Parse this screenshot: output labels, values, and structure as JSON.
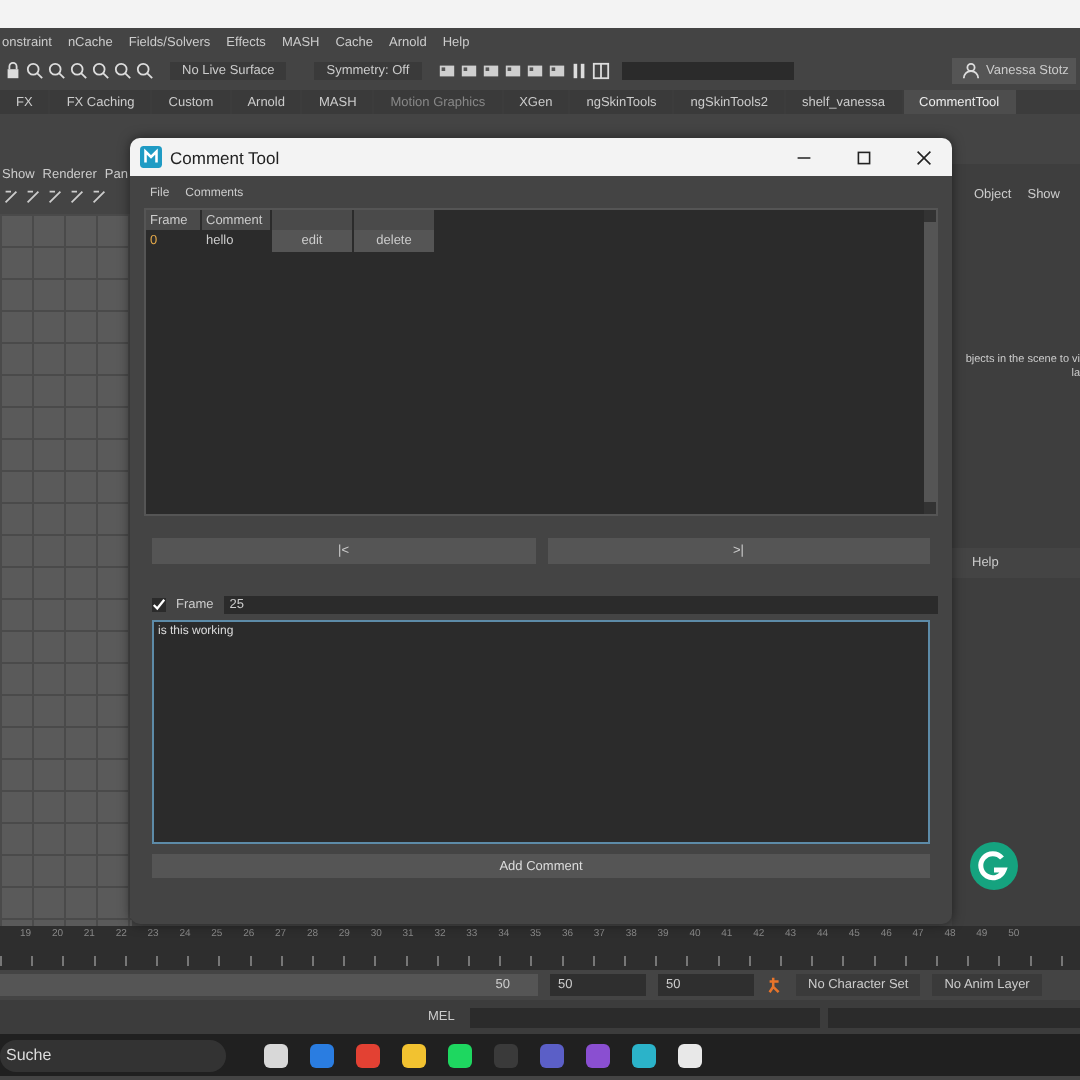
{
  "menubar": [
    "onstraint",
    "nCache",
    "Fields/Solvers",
    "Effects",
    "MASH",
    "Cache",
    "Arnold",
    "Help"
  ],
  "toolbar": {
    "surface": "No Live Surface",
    "symmetry": "Symmetry: Off",
    "user": "Vanessa Stotz"
  },
  "shelf_tabs": [
    {
      "label": "FX",
      "selected": false
    },
    {
      "label": "FX Caching",
      "selected": false
    },
    {
      "label": "Custom",
      "selected": false
    },
    {
      "label": "Arnold",
      "selected": false
    },
    {
      "label": "MASH",
      "selected": false
    },
    {
      "label": "Motion Graphics",
      "selected": false
    },
    {
      "label": "XGen",
      "selected": false
    },
    {
      "label": "ngSkinTools",
      "selected": false
    },
    {
      "label": "ngSkinTools2",
      "selected": false
    },
    {
      "label": "shelf_vanessa",
      "selected": false
    },
    {
      "label": "CommentTool",
      "selected": true
    }
  ],
  "left_panel": {
    "menu": [
      "Show",
      "Renderer",
      "Pan"
    ]
  },
  "right_panel": {
    "menu": [
      "Object",
      "Show"
    ],
    "hint_lines": [
      "bjects in the scene to vi",
      "la"
    ],
    "lower_menu": [
      "Help"
    ]
  },
  "dialog": {
    "title": "Comment Tool",
    "menu": [
      "File",
      "Comments"
    ],
    "table": {
      "columns": [
        "Frame",
        "Comment"
      ],
      "rows": [
        {
          "frame": "0",
          "comment": "hello",
          "edit": "edit",
          "delete": "delete"
        }
      ]
    },
    "nav_buttons": [
      "|<",
      ">|"
    ],
    "frame": {
      "checked": true,
      "label": "Frame",
      "value": "25"
    },
    "comment_text": "is this working",
    "add_button": "Add Comment"
  },
  "timeline": {
    "ticks": [
      "19",
      "20",
      "21",
      "22",
      "23",
      "24",
      "25",
      "26",
      "27",
      "28",
      "29",
      "30",
      "31",
      "32",
      "33",
      "34",
      "35",
      "36",
      "37",
      "38",
      "39",
      "40",
      "41",
      "42",
      "43",
      "44",
      "45",
      "46",
      "47",
      "48",
      "49",
      "50"
    ]
  },
  "range": {
    "end": "50",
    "level": 1,
    "start_field": "50",
    "end_field": "50",
    "character_set": "No Character Set",
    "anim_layer": "No Anim Layer"
  },
  "command_line": {
    "label": "MEL"
  },
  "taskbar": {
    "search": "Suche"
  }
}
